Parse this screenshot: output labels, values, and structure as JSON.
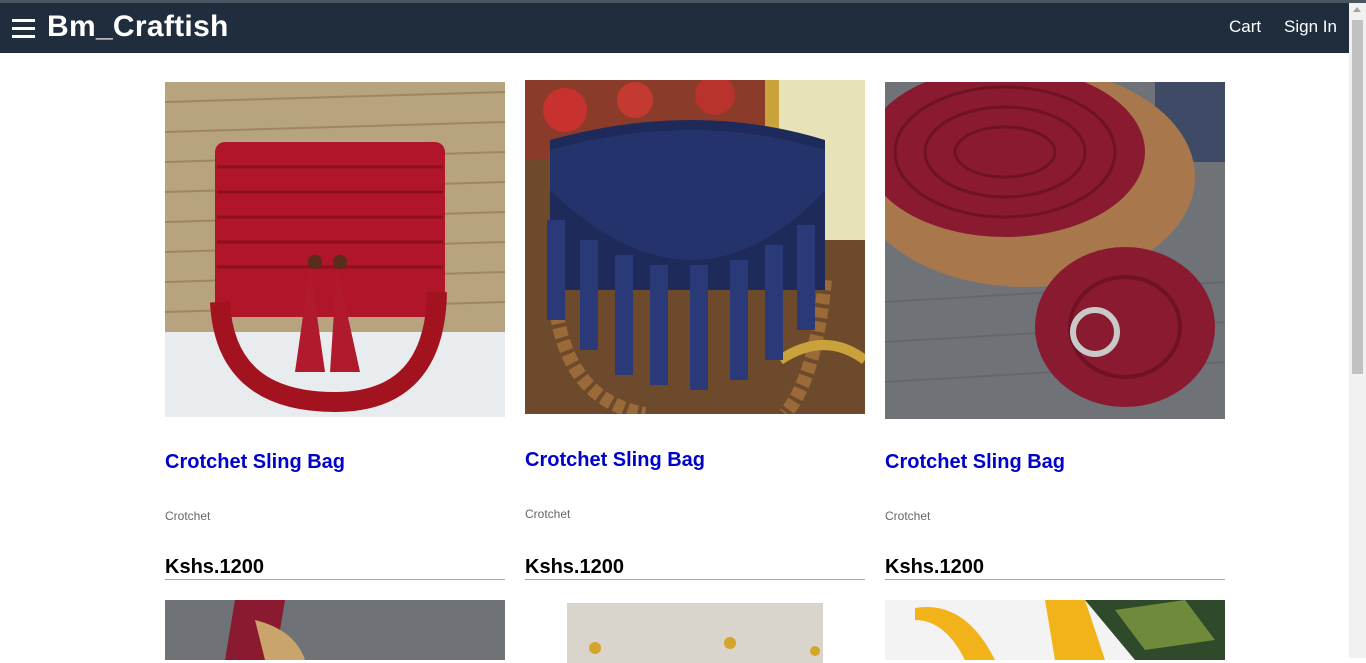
{
  "header": {
    "brand": "Bm_Craftish",
    "nav": {
      "cart": "Cart",
      "sign_in": "Sign In"
    }
  },
  "products": [
    {
      "title": "Crotchet Sling Bag",
      "category": "Crotchet",
      "price": "Kshs.1200",
      "image": "red-crochet-bag-with-chain-and-tassels"
    },
    {
      "title": "Crotchet Sling Bag",
      "category": "Crotchet",
      "price": "Kshs.1200",
      "image": "navy-crochet-bag-with-tassels"
    },
    {
      "title": "Crotchet Sling Bag",
      "category": "Crotchet",
      "price": "Kshs.1200",
      "image": "maroon-and-brown-crochet-bag"
    }
  ],
  "colors": {
    "header_bg": "#1f2d3d",
    "link": "#0000cc"
  }
}
